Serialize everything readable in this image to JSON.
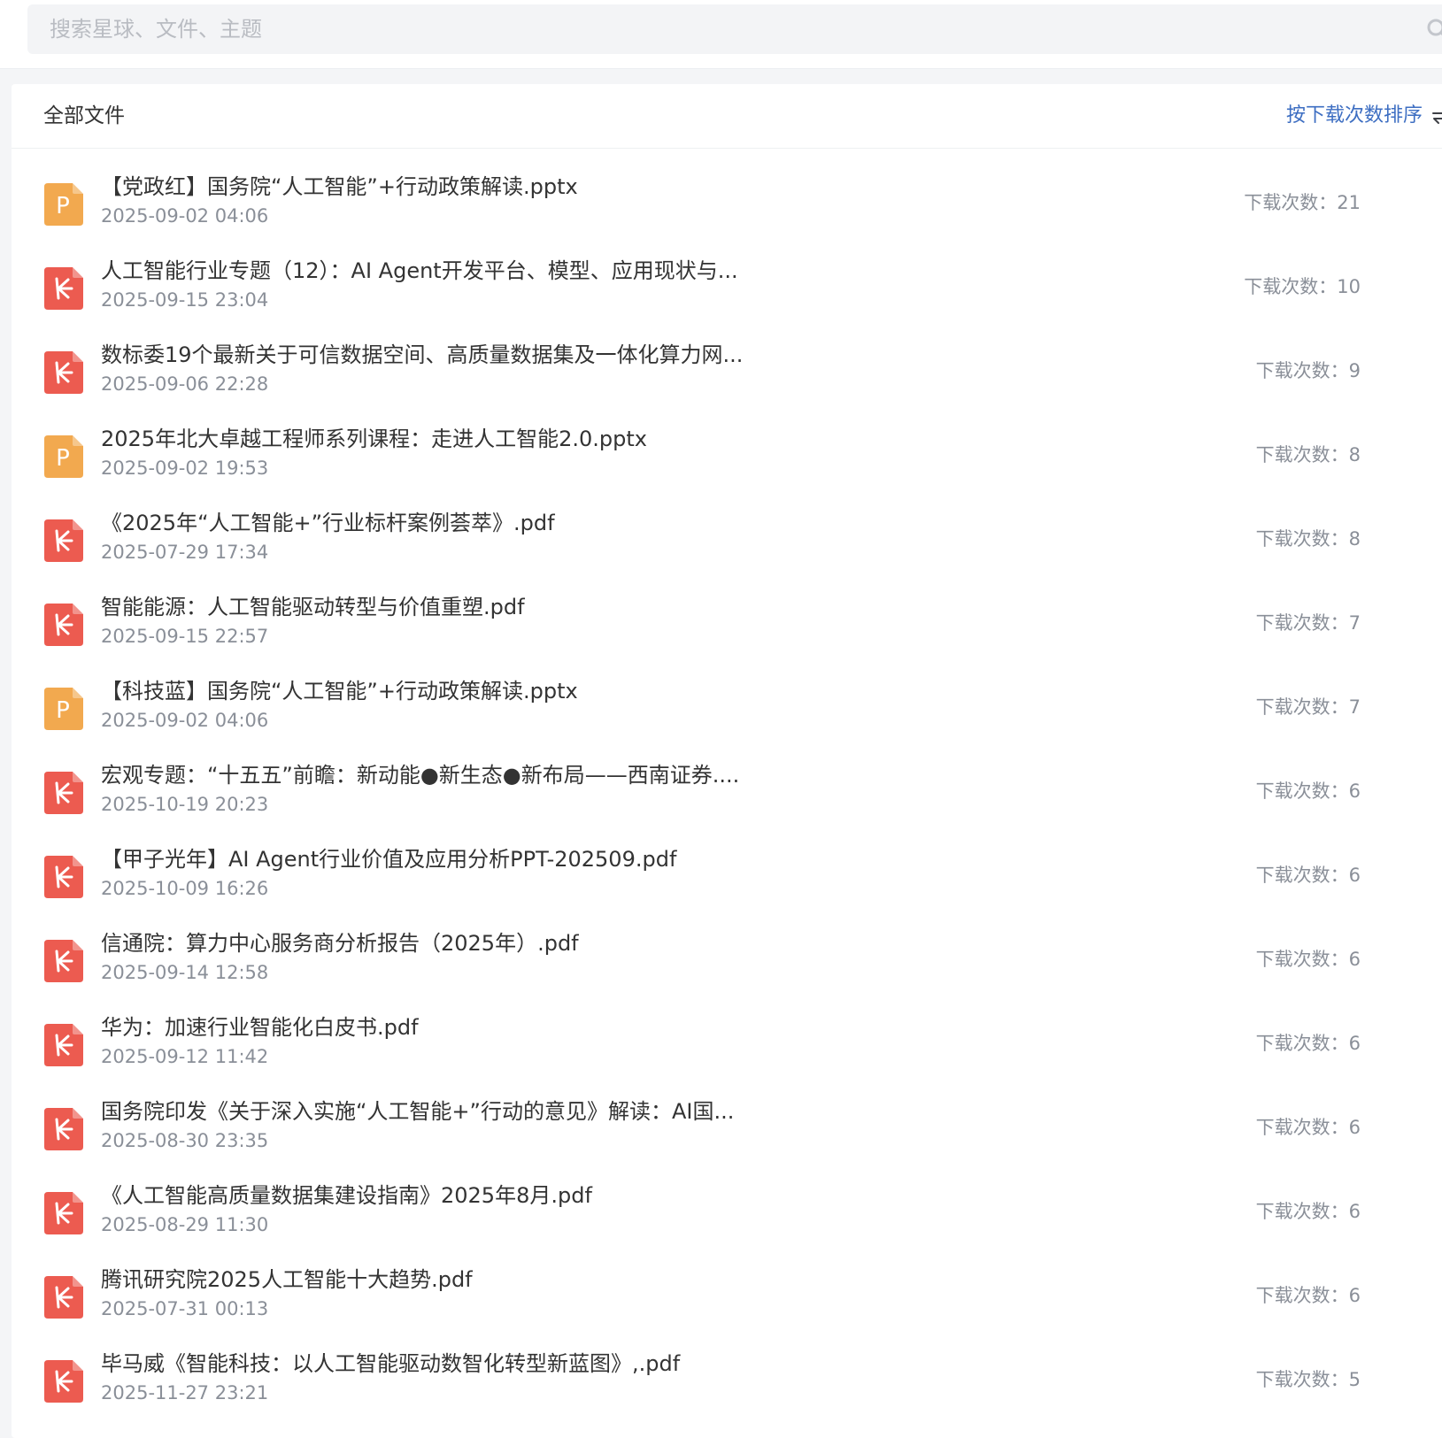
{
  "search": {
    "placeholder": "搜索星球、文件、主题"
  },
  "panel": {
    "title": "全部文件",
    "sort_label": "按下载次数排序"
  },
  "files": [
    {
      "type": "pptx",
      "name": "【党政红】国务院“人工智能”+行动政策解读.pptx",
      "date": "2025-09-02 04:06",
      "downloads": "下载次数：21"
    },
    {
      "type": "pdf",
      "name": "人工智能行业专题（12）：AI Agent开发平台、模型、应用现状与...",
      "date": "2025-09-15 23:04",
      "downloads": "下载次数：10"
    },
    {
      "type": "pdf",
      "name": "数标委19个最新关于可信数据空间、高质量数据集及一体化算力网...",
      "date": "2025-09-06 22:28",
      "downloads": "下载次数：9"
    },
    {
      "type": "pptx",
      "name": "2025年北大卓越工程师系列课程：走进人工智能2.0.pptx",
      "date": "2025-09-02 19:53",
      "downloads": "下载次数：8"
    },
    {
      "type": "pdf",
      "name": "《2025年“人工智能+”行业标杆案例荟萃》.pdf",
      "date": "2025-07-29 17:34",
      "downloads": "下载次数：8"
    },
    {
      "type": "pdf",
      "name": "智能能源：人工智能驱动转型与价值重塑.pdf",
      "date": "2025-09-15 22:57",
      "downloads": "下载次数：7"
    },
    {
      "type": "pptx",
      "name": "【科技蓝】国务院“人工智能”+行动政策解读.pptx",
      "date": "2025-09-02 04:06",
      "downloads": "下载次数：7"
    },
    {
      "type": "pdf",
      "name": "宏观专题：“十五五”前瞻：新动能●新生态●新布局——西南证券....",
      "date": "2025-10-19 20:23",
      "downloads": "下载次数：6"
    },
    {
      "type": "pdf",
      "name": "【甲子光年】AI Agent行业价值及应用分析PPT-202509.pdf",
      "date": "2025-10-09 16:26",
      "downloads": "下载次数：6"
    },
    {
      "type": "pdf",
      "name": "信通院：算力中心服务商分析报告（2025年）.pdf",
      "date": "2025-09-14 12:58",
      "downloads": "下载次数：6"
    },
    {
      "type": "pdf",
      "name": "华为：加速行业智能化白皮书.pdf",
      "date": "2025-09-12 11:42",
      "downloads": "下载次数：6"
    },
    {
      "type": "pdf",
      "name": "国务院印发《关于深入实施“人工智能+”行动的意见》解读：AI国...",
      "date": "2025-08-30 23:35",
      "downloads": "下载次数：6"
    },
    {
      "type": "pdf",
      "name": "《人工智能高质量数据集建设指南》2025年8月.pdf",
      "date": "2025-08-29 11:30",
      "downloads": "下载次数：6"
    },
    {
      "type": "pdf",
      "name": "腾讯研究院2025人工智能十大趋势.pdf",
      "date": "2025-07-31 00:13",
      "downloads": "下载次数：6"
    },
    {
      "type": "pdf",
      "name": "毕马威《智能科技：以人工智能驱动数智化转型新蓝图》,.pdf",
      "date": "2025-11-27 23:21",
      "downloads": "下载次数：5"
    }
  ],
  "icons": {
    "pptx": {
      "name": "pptx-file-icon",
      "color": "#f2a94f",
      "glyph": "P"
    },
    "pdf": {
      "name": "pdf-file-icon",
      "color": "#ec5b50"
    }
  },
  "colors": {
    "accent": "#3d6ec2",
    "muted": "#8a8f98"
  }
}
